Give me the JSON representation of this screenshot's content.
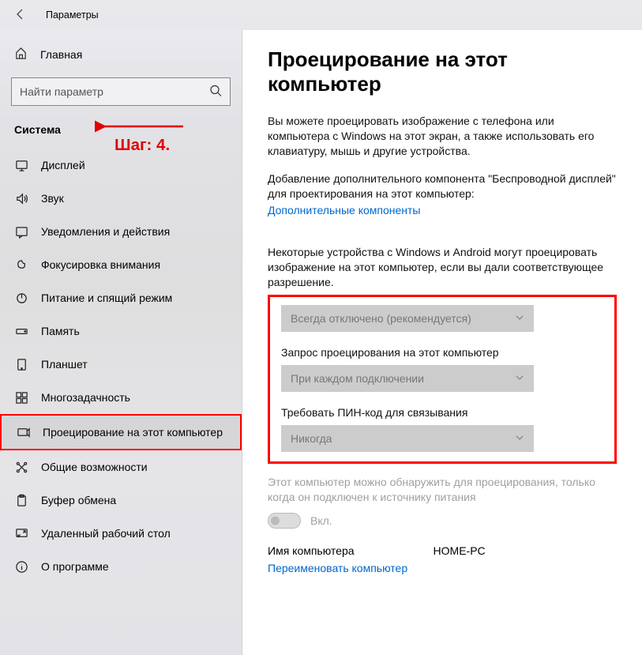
{
  "header": {
    "title": "Параметры"
  },
  "sidebar": {
    "home_label": "Главная",
    "search_placeholder": "Найти параметр",
    "category": "Система",
    "annotation": "Шаг: 4.",
    "items": [
      {
        "label": "Дисплей"
      },
      {
        "label": "Звук"
      },
      {
        "label": "Уведомления и действия"
      },
      {
        "label": "Фокусировка внимания"
      },
      {
        "label": "Питание и спящий режим"
      },
      {
        "label": "Память"
      },
      {
        "label": "Планшет"
      },
      {
        "label": "Многозадачность"
      },
      {
        "label": "Проецирование на этот компьютер"
      },
      {
        "label": "Общие возможности"
      },
      {
        "label": "Буфер обмена"
      },
      {
        "label": "Удаленный рабочий стол"
      },
      {
        "label": "О программе"
      }
    ]
  },
  "main": {
    "title": "Проецирование на этот компьютер",
    "intro": "Вы можете проецировать изображение с телефона или компьютера с Windows на этот экран, а также использовать его клавиатуру, мышь и другие устройства.",
    "add_feature": "Добавление дополнительного компонента \"Беспроводной дисплей\" для проектирования на этот компьютер:",
    "features_link": "Дополнительные компоненты",
    "para2": "Некоторые устройства с Windows и Android могут проецировать изображение на этот компьютер, если вы дали соответствующее разрешение.",
    "dd1_value": "Всегда отключено (рекомендуется)",
    "dd2_label": "Запрос проецирования на этот компьютер",
    "dd2_value": "При каждом подключении",
    "dd3_label": "Требовать ПИН-код для связывания",
    "dd3_value": "Никогда",
    "power_note": "Этот компьютер можно обнаружить для проецирования, только когда он подключен к источнику питания",
    "toggle_label": "Вкл.",
    "name_label": "Имя компьютера",
    "name_value": "HOME-PC",
    "rename_link": "Переименовать компьютер"
  }
}
